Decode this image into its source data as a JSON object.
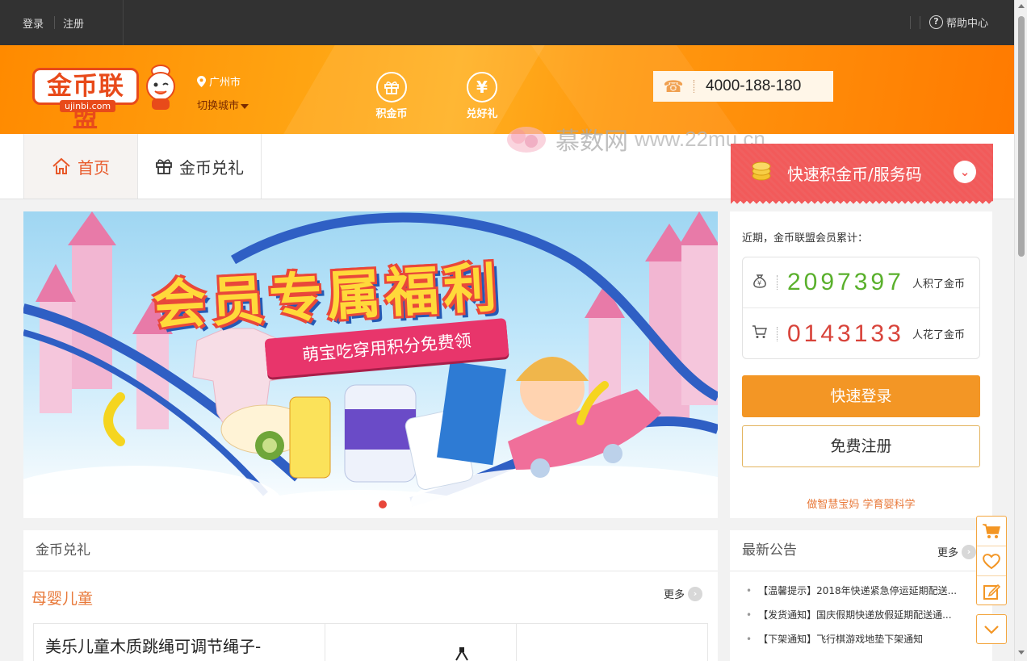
{
  "topbar": {
    "login": "登录",
    "register": "注册",
    "help": "帮助中心"
  },
  "header": {
    "logo_text": "金币联盟",
    "logo_sub": "ujinbi.com",
    "city": "广州市",
    "switch_city": "切换城市",
    "action_earn": "积金币",
    "action_redeem": "兑好礼",
    "phone": "4000-188-180"
  },
  "nav": {
    "home": "首页",
    "exchange": "金币兑礼"
  },
  "watermark": {
    "name": "慕数网",
    "url": "www.22mu.cn"
  },
  "quick_banner": {
    "label": "快速积金币/服务码"
  },
  "banner": {
    "headline": "会员专属福利",
    "ribbon": "萌宝吃穿用积分免费领",
    "colors": {
      "sky": "#9fd6f2",
      "headline": "#ffd93a",
      "ribbon": "#e8356b"
    }
  },
  "stats": {
    "intro": "近期，金币联盟会员累计：",
    "earned_count": "2097397",
    "earned_label": "人积了金币",
    "spent_count": "0143133",
    "spent_label": "人花了金币",
    "login_button": "快速登录",
    "register_button": "免费注册",
    "slogan": "做智慧宝妈 学育婴科学"
  },
  "goods": {
    "title": "金币兑礼",
    "category": "母婴儿童",
    "more": "更多",
    "items": [
      {
        "name": "美乐儿童木质跳绳可调节绳子-"
      }
    ]
  },
  "notice": {
    "title": "最新公告",
    "more": "更多",
    "items": [
      "【温馨提示】2018年快递紧急停运延期配送...",
      "【发货通知】国庆假期快递放假延期配送通...",
      "【下架通知】飞行棋游戏地垫下架通知"
    ]
  },
  "colors": {
    "accent": "#ff8a00",
    "topbar": "#323232",
    "nav_active": "#e8592a",
    "red_banner": "#f25a5a",
    "green": "#5ab02c",
    "red": "#d8433a",
    "login_btn": "#f39625"
  }
}
